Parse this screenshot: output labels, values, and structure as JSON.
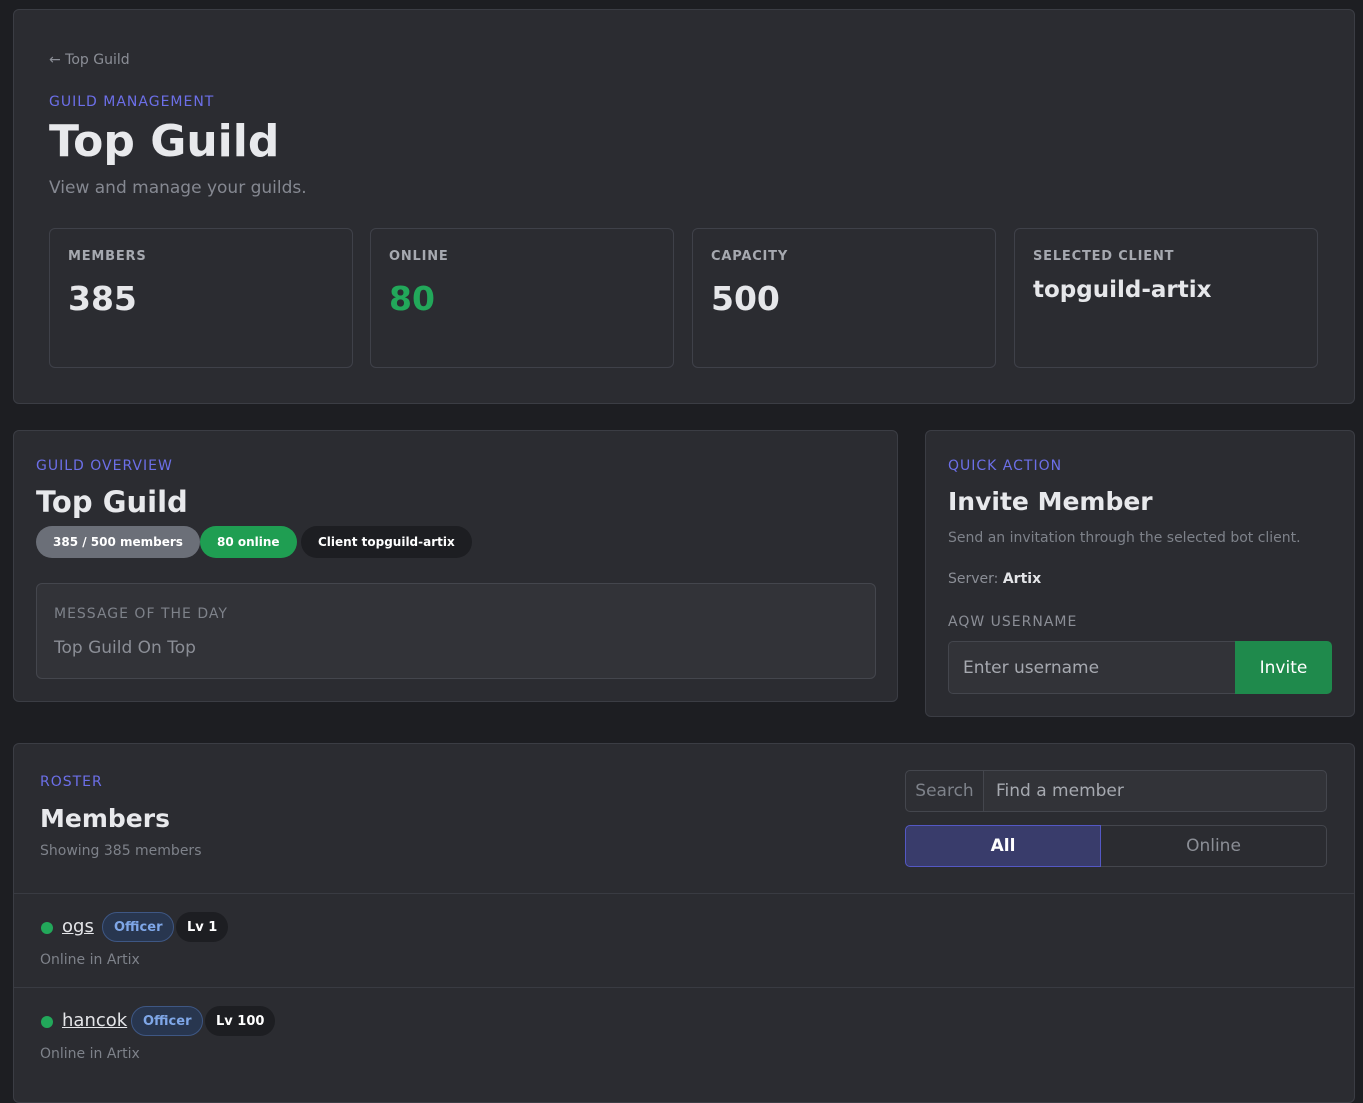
{
  "header": {
    "back_link": "← Top Guild",
    "eyebrow": "GUILD MANAGEMENT",
    "title": "Top Guild",
    "subtitle": "View and manage your guilds.",
    "stats": [
      {
        "label": "MEMBERS",
        "value": "385"
      },
      {
        "label": "ONLINE",
        "value": "80"
      },
      {
        "label": "CAPACITY",
        "value": "500"
      },
      {
        "label": "SELECTED CLIENT",
        "value": "topguild-artix"
      }
    ]
  },
  "overview": {
    "eyebrow": "GUILD OVERVIEW",
    "title": "Top Guild",
    "pills": [
      "385 / 500 members",
      "80 online",
      "Client topguild-artix"
    ],
    "motd_label": "MESSAGE OF THE DAY",
    "motd_text": "Top Guild On Top"
  },
  "quick_action": {
    "eyebrow": "QUICK ACTION",
    "title": "Invite Member",
    "description": "Send an invitation through the selected bot client.",
    "server_label": "Server:",
    "server_value": "Artix",
    "field_label": "AQW USERNAME",
    "input_placeholder": "Enter username",
    "button_label": "Invite"
  },
  "roster": {
    "eyebrow": "ROSTER",
    "title": "Members",
    "showing": "Showing 385 members",
    "search_addon": "Search",
    "search_placeholder": "Find a member",
    "filters": [
      "All",
      "Online"
    ],
    "members": [
      {
        "name": "ogs",
        "role": "Officer",
        "level": "Lv 1",
        "status": "Online in Artix"
      },
      {
        "name": "hancok",
        "role": "Officer",
        "level": "Lv 100",
        "status": "Online in Artix"
      }
    ]
  },
  "colors": {
    "accent": "#6c6fe8",
    "online_green": "#22a85a",
    "invite_button": "#1f8a4c",
    "background": "#1d1e22",
    "panel": "#2b2c31"
  }
}
